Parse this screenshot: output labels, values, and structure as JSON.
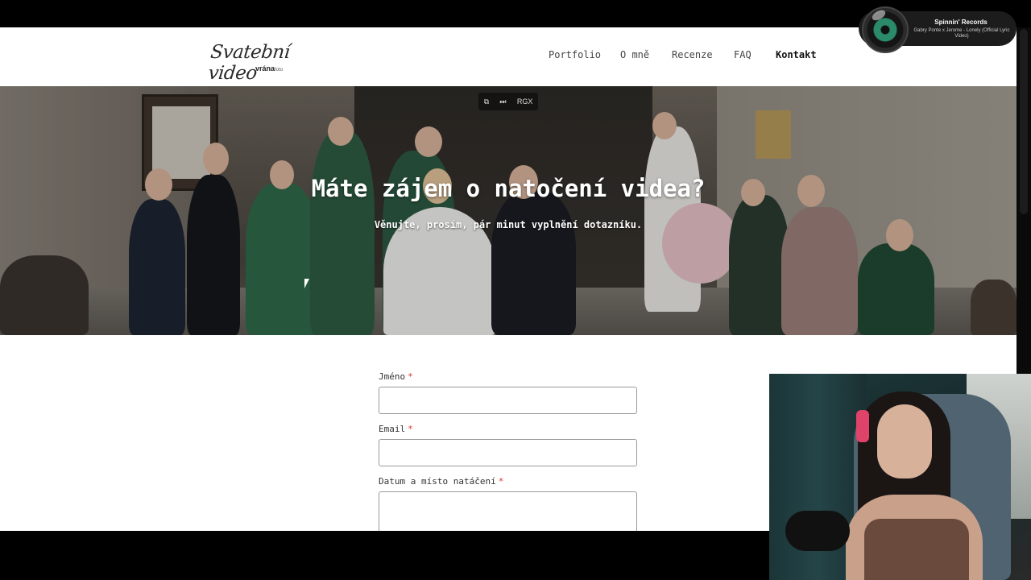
{
  "header": {
    "logo_script": "Svatební video",
    "logo_brand": "vrána",
    "logo_suffix": "foto",
    "nav": [
      "Portfolio",
      "O mně",
      "Recenze",
      "FAQ",
      "Kontakt"
    ]
  },
  "hero": {
    "title": "Máte zájem o natočení videa?",
    "subtitle": "Věnujte, prosím, pár minut vyplnění dotazníku.",
    "controls": {
      "popout_icon": "popout-icon",
      "next_icon": "skip-icon",
      "speed_label": "RGX"
    }
  },
  "form": {
    "fields": [
      {
        "label": "Jméno",
        "required_mark": "*",
        "value": ""
      },
      {
        "label": "Email",
        "required_mark": "*",
        "value": ""
      },
      {
        "label": "Datum a místo natáčení",
        "required_mark": "*",
        "value": ""
      }
    ]
  },
  "music_widget": {
    "title": "Spinnin' Records",
    "track": "Gabry Ponte x Jerome - Lonely (Official Lyric Video)"
  },
  "colors": {
    "required": "#dd3333",
    "widget_bg": "#1c1c1c"
  }
}
